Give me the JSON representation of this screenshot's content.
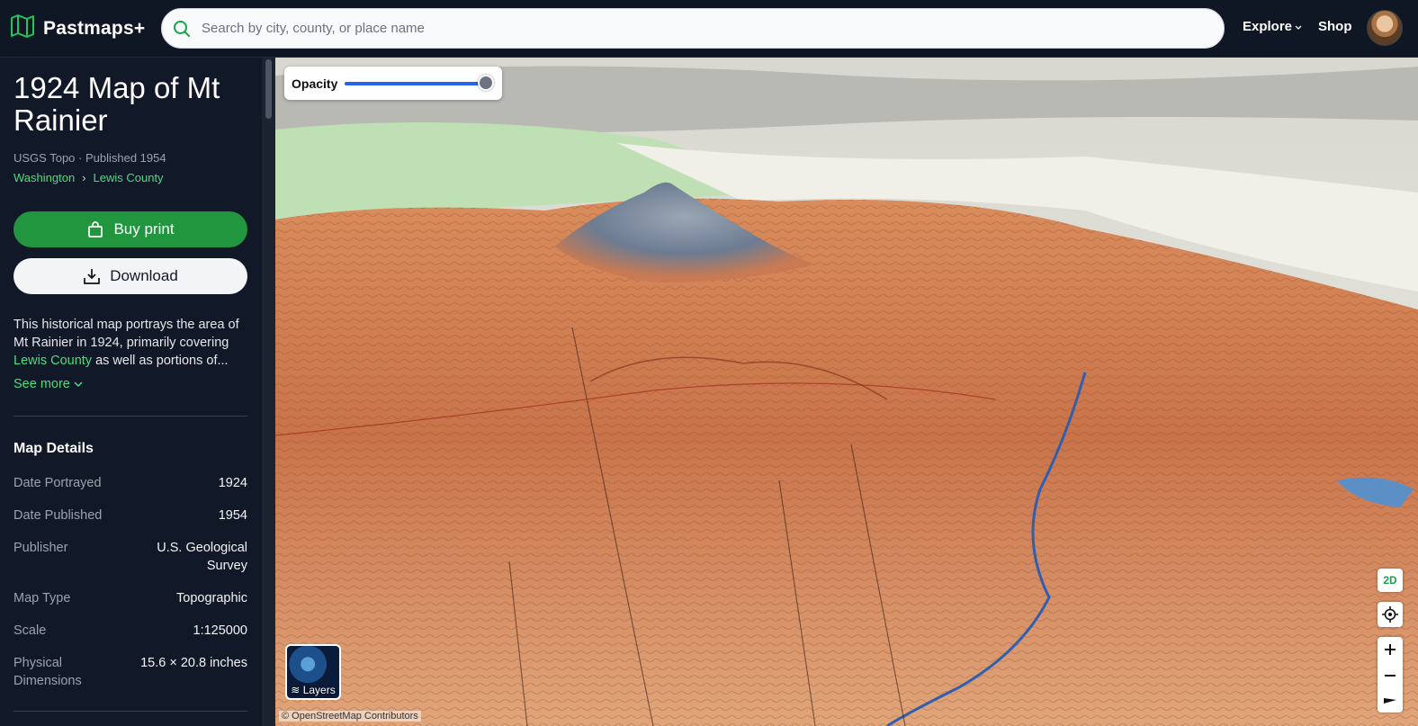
{
  "header": {
    "brand": "Pastmaps+",
    "search_placeholder": "Search by city, county, or place name",
    "nav_explore": "Explore",
    "nav_shop": "Shop"
  },
  "sidebar": {
    "title": "1924 Map of Mt Rainier",
    "meta": "USGS Topo · Published 1954",
    "breadcrumb": [
      "Washington",
      "›",
      "Lewis County"
    ],
    "buy_label": "Buy print",
    "download_label": "Download",
    "description_pre": "This historical map portrays the area of Mt Rainier in 1924, primarily covering ",
    "description_link": "Lewis County",
    "description_post": " as well as portions of...",
    "see_more": "See more",
    "details_title": "Map Details",
    "details": [
      {
        "key": "Date Portrayed",
        "value": "1924"
      },
      {
        "key": "Date Published",
        "value": "1954"
      },
      {
        "key": "Publisher",
        "value": "U.S. Geological Survey"
      },
      {
        "key": "Map Type",
        "value": "Topographic"
      },
      {
        "key": "Scale",
        "value": "1:125000"
      },
      {
        "key": "Physical Dimensions",
        "value": "15.6 × 20.8 inches"
      }
    ]
  },
  "map": {
    "opacity_label": "Opacity",
    "opacity_value": 1.0,
    "layers_label": "Layers",
    "attribution": "© OpenStreetMap Contributors",
    "mode_2d": "2D"
  },
  "colors": {
    "accent": "#22963f",
    "link": "#4ade80",
    "background": "#111827"
  }
}
